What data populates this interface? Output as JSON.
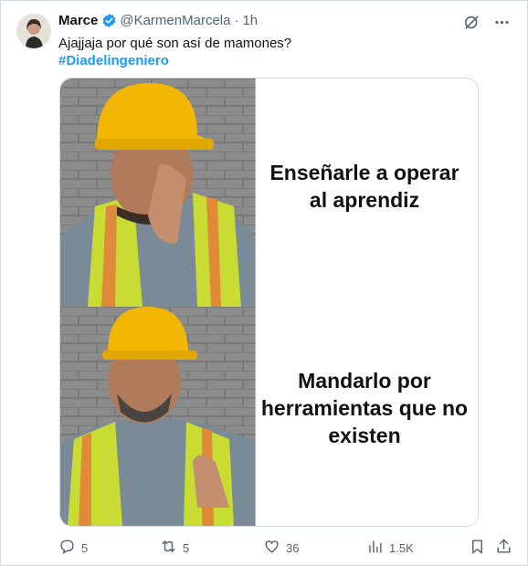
{
  "tweet": {
    "author_name": "Marce",
    "handle": "@KarmenMarcela",
    "separator": "·",
    "time": "1h",
    "text": "Ajajjaja por qué son así de mamones?",
    "hashtag": "#Diadelingeniero"
  },
  "media": {
    "caption_top": "Enseñarle a operar al aprendiz",
    "caption_bottom": "Mandarlo por herramientas que no existen"
  },
  "actions": {
    "replies": "5",
    "reposts": "5",
    "likes": "36",
    "views": "1.5K"
  },
  "icons": [
    "verified-badge-icon",
    "grok-icon",
    "more-icon",
    "reply-icon",
    "repost-icon",
    "like-icon",
    "views-icon",
    "bookmark-icon",
    "share-icon"
  ],
  "colors": {
    "accent": "#1d9bf0",
    "secondary_text": "#536471",
    "helmet": "#f2b705",
    "vest": "#d7e83a"
  }
}
